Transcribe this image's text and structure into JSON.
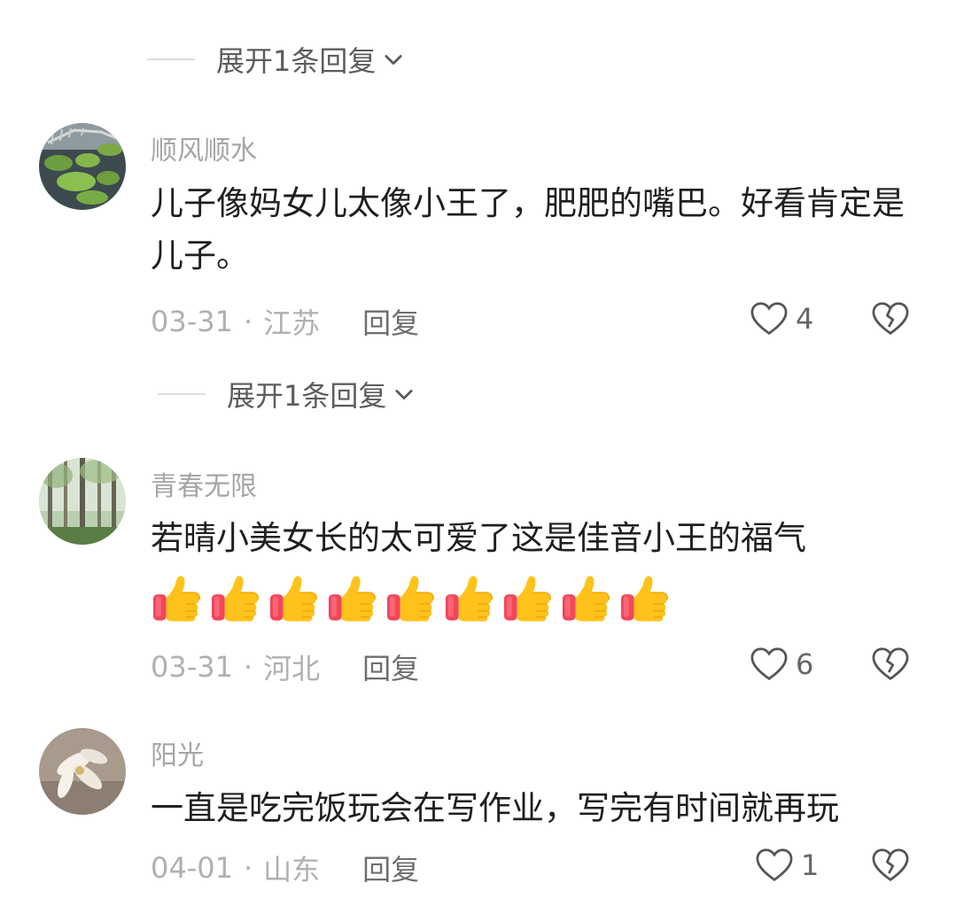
{
  "top_expand": {
    "label": "展开1条回复"
  },
  "comments": [
    {
      "username": "顺风顺水",
      "text": "儿子像妈女儿太像小王了，肥肥的嘴巴。好看肯定是儿子。",
      "date": "03-31",
      "sep": "·",
      "location": "江苏",
      "reply_label": "回复",
      "likes": "4",
      "expand_label": "展开1条回复"
    },
    {
      "username": "青春无限",
      "text": "若晴小美女长的太可爱了这是佳音小王的福气",
      "emoji": "thumbs-up",
      "emoji_count": 9,
      "date": "03-31",
      "sep": "·",
      "location": "河北",
      "reply_label": "回复",
      "likes": "6"
    },
    {
      "username": "阳光",
      "text": "一直是吃完饭玩会在写作业，写完有时间就再玩",
      "date": "04-01",
      "sep": "·",
      "location": "山东",
      "reply_label": "回复",
      "likes": "1"
    }
  ]
}
